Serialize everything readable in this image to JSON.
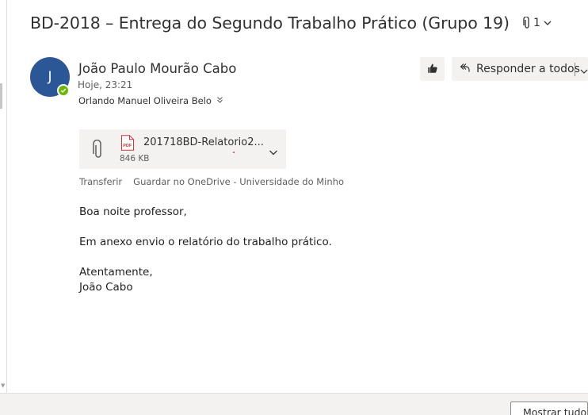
{
  "email": {
    "subject": "BD-2018 – Entrega do Segundo Trabalho Prático (Grupo 19)",
    "attachment_count": "1",
    "sender": {
      "initial": "J",
      "name": "João Paulo Mourão Cabo",
      "time": "Hoje, 23:21",
      "presence": "available"
    },
    "recipient": "Orlando Manuel Oliveira Belo",
    "actions": {
      "like_icon": "thumbs-up-icon",
      "reply_all_label": "Responder a todos"
    },
    "attachment": {
      "type_icon": "pdf-file-icon",
      "name": "201718BD-Relatorio2...",
      "size": "846 KB",
      "download_label": "Transferir",
      "save_label": "Guardar no OneDrive - Universidade do Minho"
    },
    "body": {
      "greeting": "Boa noite professor,",
      "paragraph": "Em anexo envio o relatório do trabalho prático.",
      "closing": "Atentamente,",
      "signature": "João Cabo"
    }
  },
  "footer": {
    "show_all_label": "Mostrar tudo"
  },
  "colors": {
    "avatar": "#2b5797",
    "presence": "#6bb700",
    "button_bg": "#f3f2f1",
    "pdf_red": "#d13438"
  }
}
